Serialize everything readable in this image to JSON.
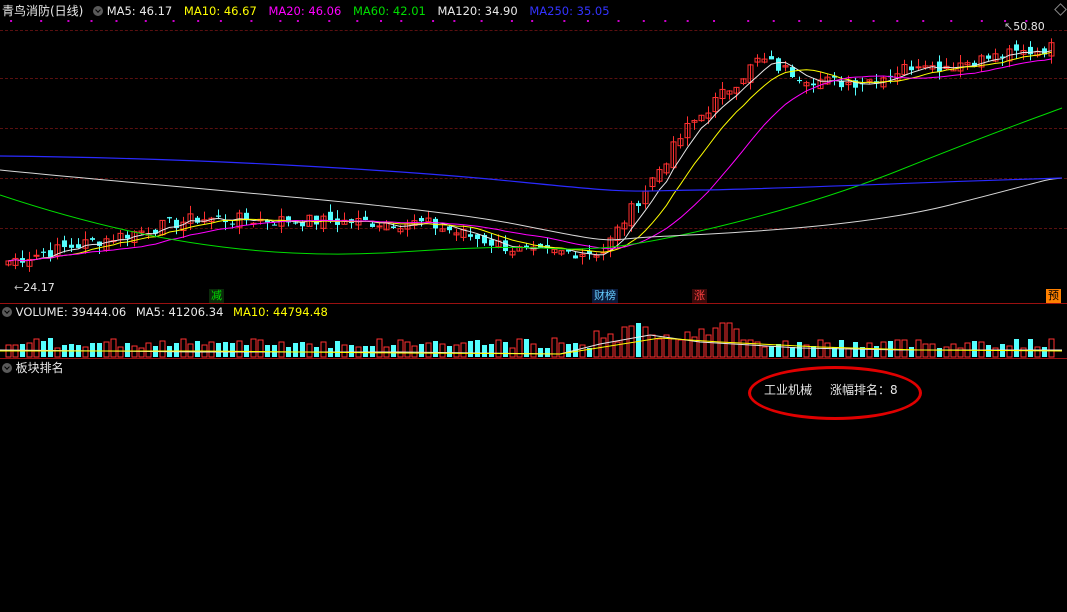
{
  "header": {
    "stock": "青鸟消防(日线)",
    "ma": [
      {
        "label": "MA5: 46.17",
        "color": "#e8e8e8"
      },
      {
        "label": "MA10: 46.67",
        "color": "#ffff00"
      },
      {
        "label": "MA20: 46.06",
        "color": "#ff00ff"
      },
      {
        "label": "MA60: 42.01",
        "color": "#00dd00"
      },
      {
        "label": "MA120: 34.90",
        "color": "#e8e8e8"
      },
      {
        "label": "MA250: 35.05",
        "color": "#2222ff"
      }
    ]
  },
  "price_high": "50.80",
  "price_low": "24.17",
  "markers": [
    {
      "text": "减",
      "color": "#00dd00",
      "bg": "#0a2a0a"
    },
    {
      "text": "财榜",
      "color": "#66ccff",
      "bg": "#0a1a3a"
    },
    {
      "text": "涨",
      "color": "#ff4040",
      "bg": "#3a0a0a"
    },
    {
      "text": "预",
      "color": "#000000",
      "bg": "#ff8000"
    }
  ],
  "volume": {
    "label": "VOLUME: 39444.06",
    "ma5": "MA5: 41206.34",
    "ma10": "MA10: 44794.48"
  },
  "panel3": {
    "title": "板块排名",
    "sector": "工业机械",
    "rank_label": "涨幅排名：8"
  },
  "colors": {
    "up": "#ff3030",
    "down": "#54ffff",
    "grid": "#5a1010",
    "border": "#9a1010"
  }
}
